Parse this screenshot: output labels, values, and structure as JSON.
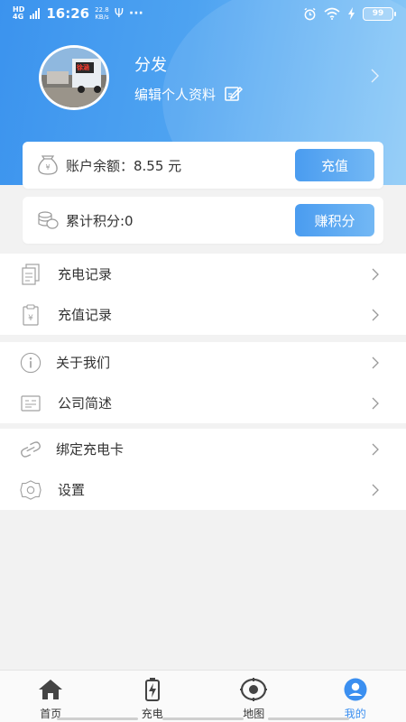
{
  "status_bar": {
    "network": "4G",
    "network_sub": "HD",
    "time": "16:26",
    "speed_value": "22.8",
    "speed_unit": "KB/s",
    "usb_glyph": "Ψ",
    "more": "···",
    "battery": "99"
  },
  "profile": {
    "name": "分发",
    "edit_label": "编辑个人资料",
    "avatar_text": "徐涵"
  },
  "account": {
    "balance_text": "账户余额：8.55 元",
    "recharge_button": "充值",
    "points_text": "累计积分:0",
    "earn_button": "赚积分"
  },
  "menu": {
    "group1": [
      {
        "label": "充电记录",
        "icon": "document-icon"
      },
      {
        "label": "充值记录",
        "icon": "clipboard-yuan-icon"
      }
    ],
    "group2": [
      {
        "label": "关于我们",
        "icon": "info-icon"
      },
      {
        "label": "公司简述",
        "icon": "card-icon"
      }
    ],
    "group3": [
      {
        "label": "绑定充电卡",
        "icon": "link-icon"
      },
      {
        "label": "设置",
        "icon": "gear-icon"
      }
    ]
  },
  "tabbar": {
    "tabs": [
      {
        "label": "首页",
        "icon": "home-icon",
        "active": false
      },
      {
        "label": "充电",
        "icon": "battery-charge-icon",
        "active": false
      },
      {
        "label": "地图",
        "icon": "location-icon",
        "active": false
      },
      {
        "label": "我的",
        "icon": "user-icon",
        "active": true
      }
    ]
  },
  "colors": {
    "accent": "#3b8ff0",
    "header_start": "#3b93ee",
    "header_end": "#8ccaf7"
  }
}
